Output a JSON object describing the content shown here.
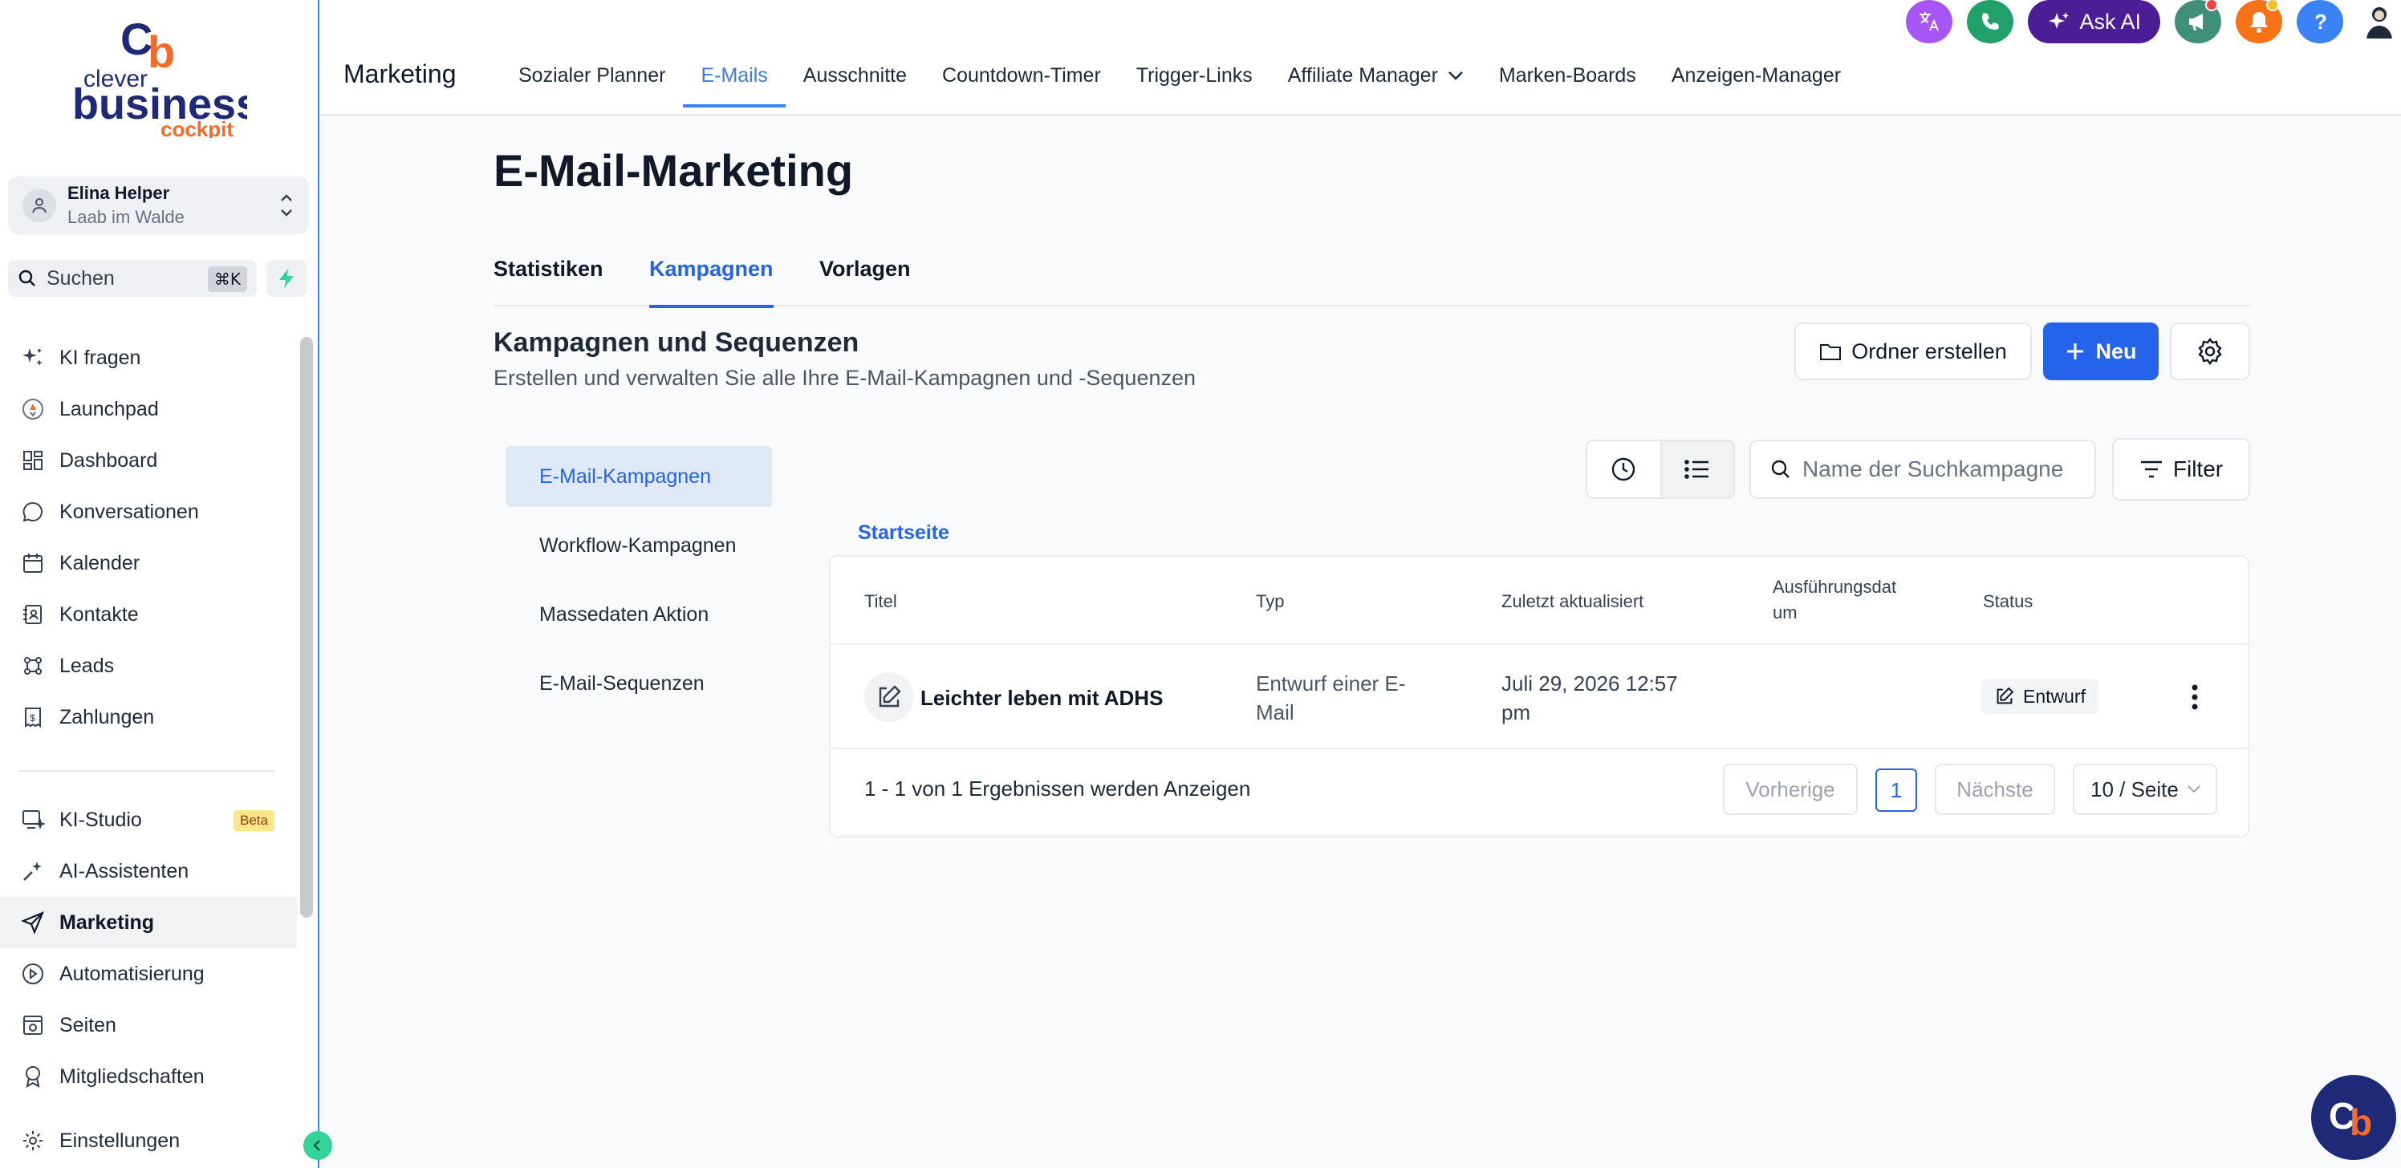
{
  "brand": {
    "logo_top": "clever",
    "logo_main": "business",
    "logo_sub": "cockpit",
    "colors": {
      "accent": "#2563eb",
      "brand_navy": "#1e2a78",
      "brand_orange": "#f26b2a"
    }
  },
  "account": {
    "name": "Elina Helper",
    "location": "Laab im Walde",
    "icon": "user-icon"
  },
  "search": {
    "label": "Suchen",
    "shortcut": "⌘K"
  },
  "sidebar": {
    "items": [
      {
        "label": "KI fragen",
        "icon": "sparkle-icon"
      },
      {
        "label": "Launchpad",
        "icon": "rocket-icon"
      },
      {
        "label": "Dashboard",
        "icon": "grid-icon"
      },
      {
        "label": "Konversationen",
        "icon": "chat-icon"
      },
      {
        "label": "Kalender",
        "icon": "calendar-icon"
      },
      {
        "label": "Kontakte",
        "icon": "contacts-icon"
      },
      {
        "label": "Leads",
        "icon": "leads-icon"
      },
      {
        "label": "Zahlungen",
        "icon": "payment-icon"
      }
    ],
    "items2": [
      {
        "label": "KI-Studio",
        "icon": "ai-studio-icon",
        "badge": "Beta"
      },
      {
        "label": "AI-Assistenten",
        "icon": "assistant-icon"
      },
      {
        "label": "Marketing",
        "icon": "send-icon",
        "active": true
      },
      {
        "label": "Automatisierung",
        "icon": "automation-icon"
      },
      {
        "label": "Seiten",
        "icon": "pages-icon"
      },
      {
        "label": "Mitgliedschaften",
        "icon": "award-icon"
      },
      {
        "label": "Einstellungen",
        "icon": "gear-icon"
      }
    ]
  },
  "topbar": {
    "module": "Marketing",
    "tabs": [
      {
        "label": "Sozialer Planner"
      },
      {
        "label": "E-Mails",
        "active": true
      },
      {
        "label": "Ausschnitte"
      },
      {
        "label": "Countdown-Timer"
      },
      {
        "label": "Trigger-Links"
      },
      {
        "label": "Affiliate Manager",
        "dropdown": true
      },
      {
        "label": "Marken-Boards"
      },
      {
        "label": "Anzeigen-Manager"
      }
    ],
    "ask_ai": "Ask AI"
  },
  "main": {
    "title": "E-Mail-Marketing",
    "subtabs": [
      "Statistiken",
      "Kampagnen",
      "Vorlagen"
    ],
    "active_subtab": "Kampagnen",
    "section_title": "Kampagnen und Sequenzen",
    "section_subtitle": "Erstellen und verwalten Sie alle Ihre E-Mail-Kampagnen und -Sequenzen",
    "btn_folder": "Ordner erstellen",
    "btn_new": "Neu",
    "left_list": [
      "E-Mail-Kampagnen",
      "Workflow-Kampagnen",
      "Massedaten Aktion",
      "E-Mail-Sequenzen"
    ],
    "search_placeholder": "Name der Suchkampagne",
    "filter": "Filter",
    "breadcrumb": "Startseite"
  },
  "table": {
    "headers": [
      "Titel",
      "Typ",
      "Zuletzt aktualisiert",
      "Ausführungsdat\num",
      "Status"
    ],
    "rows": [
      {
        "title": "Leichter leben mit ADHS",
        "type": "Entwurf einer E-\nMail",
        "updated": "Juli 29, 2026 12:57\npm",
        "executed": "",
        "status": "Entwurf"
      }
    ],
    "results": "1 - 1 von 1 Ergebnissen werden Anzeigen",
    "prev": "Vorherige",
    "page": "1",
    "next": "Nächste",
    "per_page": "10 / Seite"
  }
}
